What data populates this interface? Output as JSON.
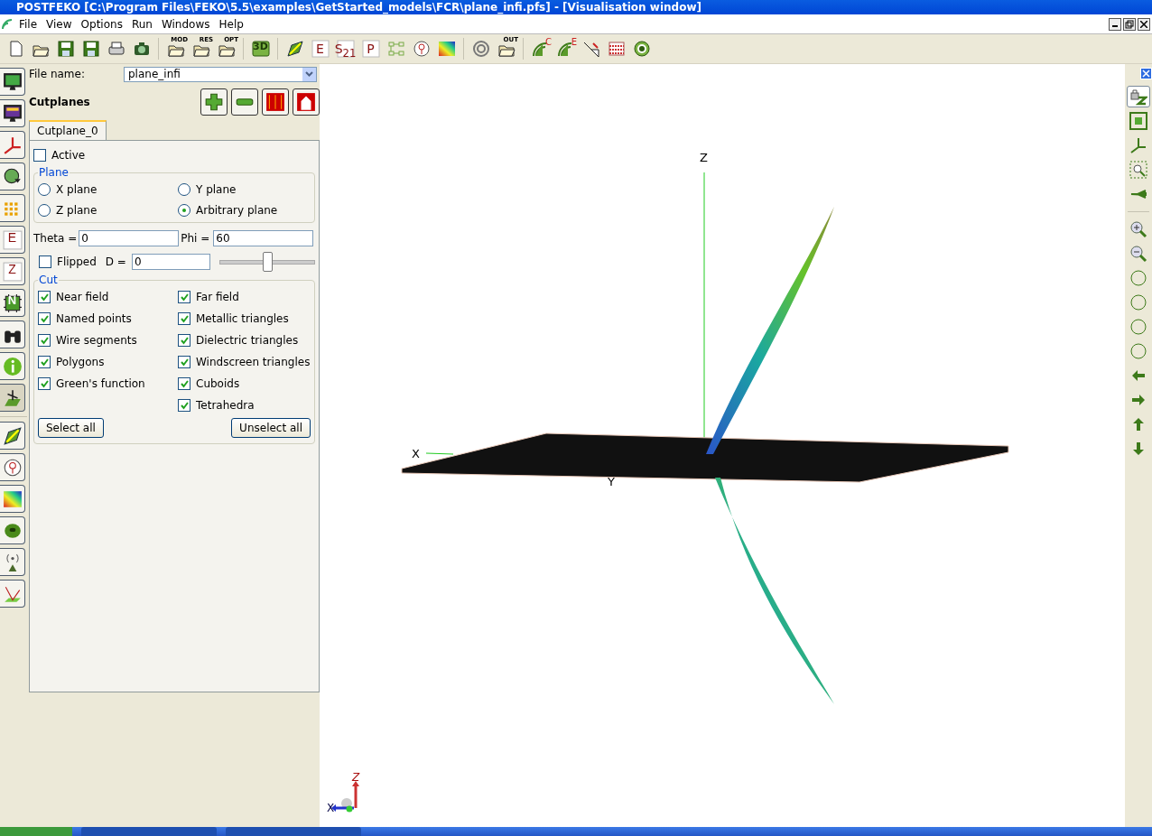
{
  "window": {
    "title": "POSTFEKO [C:\\Program Files\\FEKO\\5.5\\examples\\GetStarted_models\\FCR\\plane_infi.pfs] - [Visualisation window]"
  },
  "menu": [
    "File",
    "View",
    "Options",
    "Run",
    "Windows",
    "Help"
  ],
  "toolbar": [
    {
      "kind": "new"
    },
    {
      "kind": "open"
    },
    {
      "kind": "save"
    },
    {
      "kind": "save-as"
    },
    {
      "kind": "print"
    },
    {
      "kind": "camera"
    },
    {
      "kind": "sep"
    },
    {
      "kind": "folder",
      "label": "MOD"
    },
    {
      "kind": "folder",
      "label": "RES"
    },
    {
      "kind": "folder",
      "label": "OPT"
    },
    {
      "kind": "sep"
    },
    {
      "kind": "badge",
      "label": "3D"
    },
    {
      "kind": "sep"
    },
    {
      "kind": "arrow3d"
    },
    {
      "kind": "letter",
      "label": "E"
    },
    {
      "kind": "letter",
      "label": "S$_{21}$"
    },
    {
      "kind": "letter",
      "label": "P"
    },
    {
      "kind": "network"
    },
    {
      "kind": "marker"
    },
    {
      "kind": "colormap"
    },
    {
      "kind": "sep"
    },
    {
      "kind": "target-grey"
    },
    {
      "kind": "folder",
      "label": "OUT"
    },
    {
      "kind": "sep"
    },
    {
      "kind": "wave",
      "label": "C"
    },
    {
      "kind": "wave",
      "label": "E"
    },
    {
      "kind": "arrows"
    },
    {
      "kind": "abacus"
    },
    {
      "kind": "target"
    }
  ],
  "file_name": {
    "label": "File name:",
    "value": "plane_infi"
  },
  "left_tools": [
    {
      "kind": "monitor",
      "selected": false
    },
    {
      "kind": "monitor-color",
      "selected": false
    },
    {
      "kind": "axes",
      "selected": false
    },
    {
      "kind": "sphere",
      "selected": false
    },
    {
      "kind": "dots",
      "selected": false
    },
    {
      "kind": "letter",
      "label": "E",
      "selected": false
    },
    {
      "kind": "letter",
      "label": "Z",
      "selected": false
    },
    {
      "kind": "chip",
      "label": "N",
      "selected": false
    },
    {
      "kind": "binoculars",
      "selected": false
    },
    {
      "kind": "info",
      "selected": false
    },
    {
      "kind": "cutplane",
      "selected": true
    },
    {
      "kind": "sep"
    },
    {
      "kind": "arrow3d",
      "selected": false
    },
    {
      "kind": "marker",
      "selected": false
    },
    {
      "kind": "colormap",
      "selected": false
    },
    {
      "kind": "torus",
      "selected": false
    },
    {
      "kind": "antenna",
      "selected": false
    },
    {
      "kind": "reflect",
      "selected": false
    }
  ],
  "panel": {
    "title": "Cutplanes",
    "actions": [
      {
        "kind": "add"
      },
      {
        "kind": "remove"
      },
      {
        "kind": "curtain-closed"
      },
      {
        "kind": "curtain-open"
      }
    ],
    "tabs": [
      {
        "label": "Cutplane_0",
        "selected": true
      }
    ],
    "active": {
      "label": "Active",
      "checked": false
    },
    "plane": {
      "title": "Plane",
      "options": [
        {
          "label": "X plane",
          "selected": false
        },
        {
          "label": "Y plane",
          "selected": false
        },
        {
          "label": "Z plane",
          "selected": false
        },
        {
          "label": "Arbitrary plane",
          "selected": true
        }
      ]
    },
    "theta": {
      "label": "Theta =",
      "value": "0"
    },
    "phi": {
      "label": "Phi =",
      "value": "60"
    },
    "flipped": {
      "label": "Flipped",
      "checked": false
    },
    "d": {
      "label": "D =",
      "value": "0"
    },
    "d_slider": {
      "level": 0.5
    },
    "cut": {
      "title": "Cut",
      "left": [
        {
          "label": "Near field",
          "checked": true
        },
        {
          "label": "Named points",
          "checked": true
        },
        {
          "label": "Wire segments",
          "checked": true
        },
        {
          "label": "Polygons",
          "checked": true
        },
        {
          "label": "Green's function",
          "checked": true
        }
      ],
      "right": [
        {
          "label": "Far field",
          "checked": true
        },
        {
          "label": "Metallic triangles",
          "checked": true
        },
        {
          "label": "Dielectric triangles",
          "checked": true
        },
        {
          "label": "Windscreen triangles",
          "checked": true
        },
        {
          "label": "Cuboids",
          "checked": true
        },
        {
          "label": "Tetrahedra",
          "checked": true
        }
      ]
    },
    "buttons": [
      "Select all",
      "Unselect all"
    ]
  },
  "scene": {
    "axis_labels": [
      "Z",
      "X",
      "Y"
    ],
    "triad_labels": [
      "X",
      "Z"
    ]
  },
  "right_tools": [
    {
      "kind": "lock-z",
      "selected": true
    },
    {
      "kind": "fit",
      "selected": false
    },
    {
      "kind": "axes-r",
      "selected": false
    },
    {
      "kind": "zoom-box",
      "selected": false
    },
    {
      "kind": "back",
      "selected": false
    },
    {
      "kind": "sep"
    },
    {
      "kind": "zoom-in",
      "selected": false
    },
    {
      "kind": "zoom-out",
      "selected": false
    },
    {
      "kind": "rot-phi-l",
      "selected": false
    },
    {
      "kind": "rot-phi-r",
      "selected": false
    },
    {
      "kind": "rot-theta-r",
      "selected": false
    },
    {
      "kind": "rot-theta-l",
      "selected": false
    },
    {
      "kind": "left",
      "selected": false
    },
    {
      "kind": "right",
      "selected": false
    },
    {
      "kind": "up",
      "selected": false
    },
    {
      "kind": "down",
      "selected": false
    }
  ]
}
